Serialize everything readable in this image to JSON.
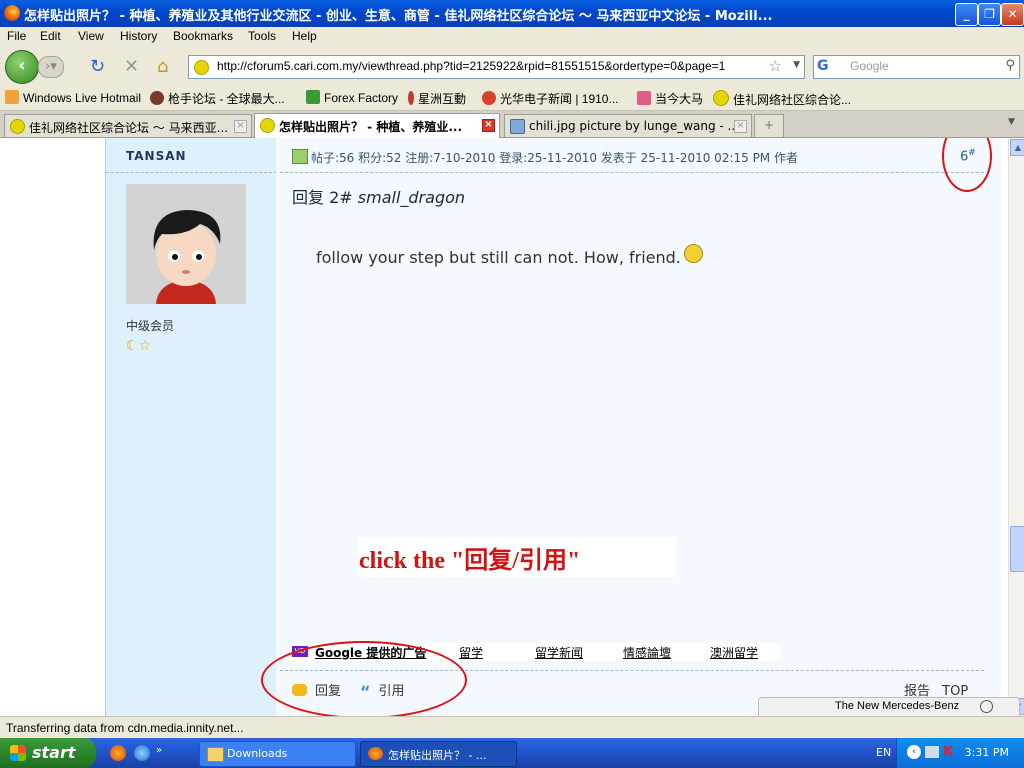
{
  "window": {
    "title": "怎样贴出照片？ - 种植、养殖业及其他行业交流区 - 创业、生意、商管 - 佳礼网络社区综合论坛 ～ 马来西亚中文论坛 - Mozill..."
  },
  "menu": [
    "File",
    "Edit",
    "View",
    "History",
    "Bookmarks",
    "Tools",
    "Help"
  ],
  "nav": {
    "url": "http://cforum5.cari.com.my/viewthread.php?tid=2125922&rpid=81551515&ordertype=0&page=1",
    "search_placeholder": "Google"
  },
  "bookmarks": [
    "Windows Live Hotmail",
    "枪手论坛 - 全球最大...",
    "Forex Factory",
    "星洲互動",
    "光华电子新闻 | 1910...",
    "当今大马",
    "佳礼网络社区综合论..."
  ],
  "tabs": [
    {
      "label": "佳礼网络社区综合论坛 ～ 马来西亚..."
    },
    {
      "label": "怎样贴出照片？ - 种植、养殖业..."
    },
    {
      "label": "chili.jpg picture by lunge_wang - ..."
    }
  ],
  "post": {
    "username": "TANSAN",
    "rank": "中级会员",
    "stars": "☾☆",
    "meta": "帖子:56  积分:52  注册:7-10-2010  登录:25-11-2010 发表于 25-11-2010 02:15 PM  作者",
    "floor_number": "6",
    "floor_mark": "#",
    "reply_prefix": "回复 2#",
    "reply_user": "small_dragon",
    "message": "follow your step but still can not. How, friend."
  },
  "annotation": {
    "text": "click the \"回复/引用\"",
    "color": "#d01212"
  },
  "ads": {
    "label": "Google 提供的广告",
    "links": [
      "留学",
      "留学新闻",
      "情感論壇",
      "澳洲留学"
    ]
  },
  "actions": {
    "reply": "回复",
    "quote": "引用",
    "report": "报告",
    "top": "TOP"
  },
  "popup_ad": "The New Mercedes-Benz",
  "status": "Transferring data from cdn.media.innity.net...",
  "taskbar": {
    "start": "start",
    "tasks": [
      "Downloads",
      "怎样贴出照片？ - ..."
    ],
    "lang": "EN",
    "clock": "3:31 PM"
  }
}
